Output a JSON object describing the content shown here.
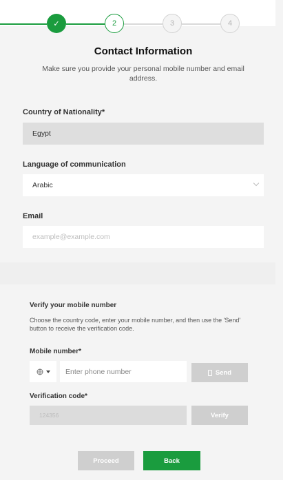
{
  "stepper": {
    "steps": [
      {
        "label": "✓",
        "state": "done"
      },
      {
        "label": "2",
        "state": "current"
      },
      {
        "label": "3",
        "state": "todo"
      },
      {
        "label": "4",
        "state": "todo"
      }
    ],
    "colors": {
      "active": "#1a9c3e",
      "inactive": "#d3d3d3"
    }
  },
  "header": {
    "title": "Contact Information",
    "subtitle": "Make sure you provide your personal mobile number and email address."
  },
  "form": {
    "nationality_label": "Country of Nationality*",
    "nationality_value": "Egypt",
    "language_label": "Language of communication",
    "language_value": "Arabic",
    "email_label": "Email",
    "email_placeholder": "example@example.com"
  },
  "verify": {
    "heading": "Verify your mobile number",
    "instructions": "Choose the country code, enter your mobile number, and then use the 'Send' button to receive the verification code.",
    "mobile_label": "Mobile number*",
    "country_code_icon": "globe-icon",
    "phone_placeholder": "Enter phone number",
    "send_label": "Send",
    "code_label": "Verification code*",
    "code_placeholder": "124356",
    "verify_label": "Verify"
  },
  "actions": {
    "proceed_label": "Proceed",
    "back_label": "Back"
  }
}
